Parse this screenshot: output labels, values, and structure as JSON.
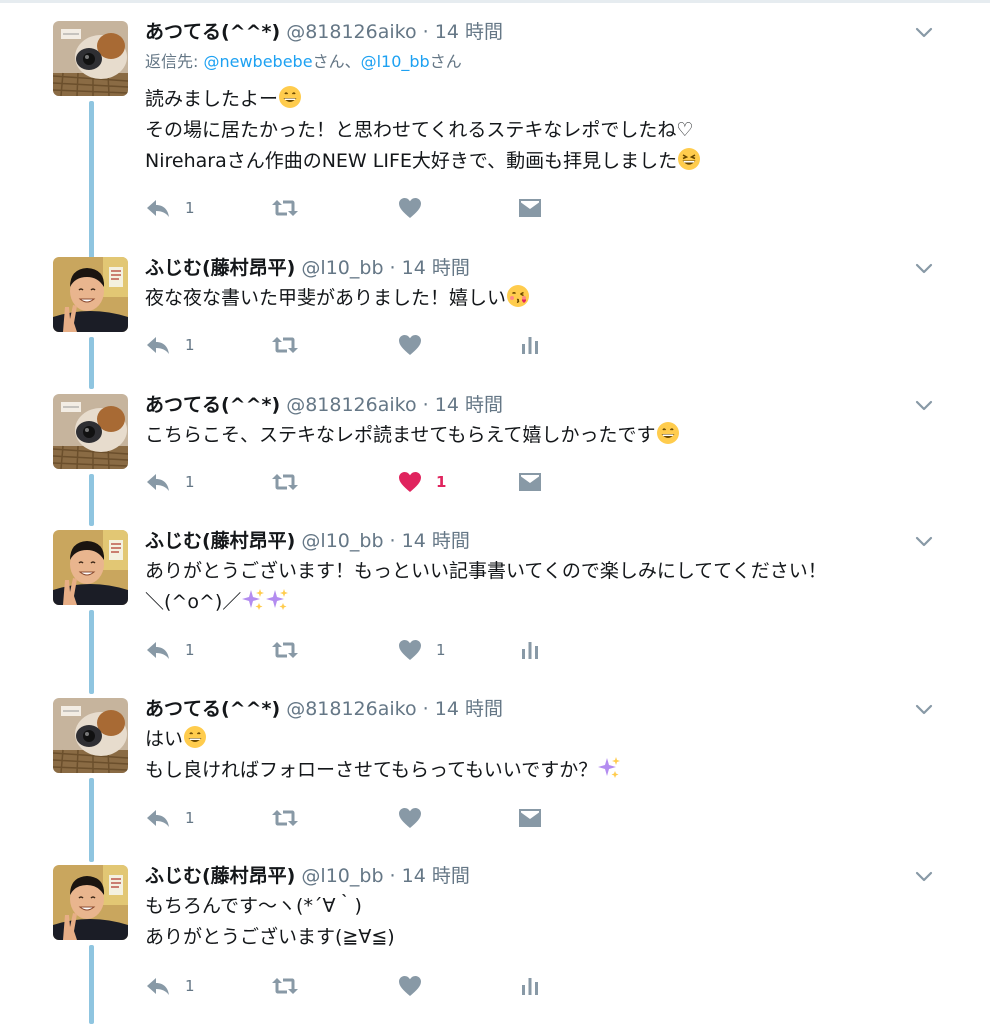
{
  "users": {
    "atsuteru": {
      "name": "あつてる(^^*)",
      "handle": "@818126aiko"
    },
    "fujimu": {
      "name": "ふじむ(藤村昂平)",
      "handle": "@l10_bb"
    }
  },
  "colors": {
    "accent": "#1da1f2",
    "like": "#e0245e",
    "muted": "#657786",
    "thread": "#8fc5e0"
  },
  "tweets": [
    {
      "time": "14 時間",
      "reply_label": "返信先: ",
      "reply_user1": "@newbebebe",
      "reply_sep": "さん、",
      "reply_user2": "@l10_bb",
      "reply_end": "さん",
      "lines": [
        "読みましたよー",
        "その場に居たかった！と思わせてくれるステキなレポでしたね♡",
        "Nireharaさん作曲のNEW LIFE大好きで、動画も拝見しました"
      ],
      "emojis": [
        "grinning-emoji",
        "laughing-emoji"
      ],
      "reply_count": "1",
      "like_count": "",
      "last_action": "dm-icon"
    },
    {
      "time": "14 時間",
      "lines": [
        "夜な夜な書いた甲斐がありました！嬉しい"
      ],
      "emojis": [
        "kissing-emoji"
      ],
      "reply_count": "1",
      "like_count": "",
      "last_action": "analytics-icon"
    },
    {
      "time": "14 時間",
      "lines": [
        "こちらこそ、ステキなレポ読ませてもらえて嬉しかったです"
      ],
      "emojis": [
        "grinning-emoji"
      ],
      "reply_count": "1",
      "like_count": "1",
      "liked": true,
      "last_action": "dm-icon"
    },
    {
      "time": "14 時間",
      "lines": [
        "ありがとうございます！もっといい記事書いてくので楽しみにしててください！",
        "＼(^o^)／"
      ],
      "emojis": [
        "sparkles-emoji",
        "sparkles-emoji"
      ],
      "reply_count": "1",
      "like_count": "1",
      "last_action": "analytics-icon"
    },
    {
      "time": "14 時間",
      "lines": [
        "はい",
        "もし良ければフォローさせてもらってもいいですか？"
      ],
      "emojis": [
        "grinning-emoji",
        "sparkles-emoji"
      ],
      "reply_count": "1",
      "like_count": "",
      "last_action": "dm-icon"
    },
    {
      "time": "14 時間",
      "lines": [
        "もちろんです〜ヽ(*´∀｀)",
        "ありがとうございます(≧∀≦)"
      ],
      "emojis": [],
      "reply_count": "1",
      "like_count": "",
      "last_action": "analytics-icon"
    }
  ]
}
